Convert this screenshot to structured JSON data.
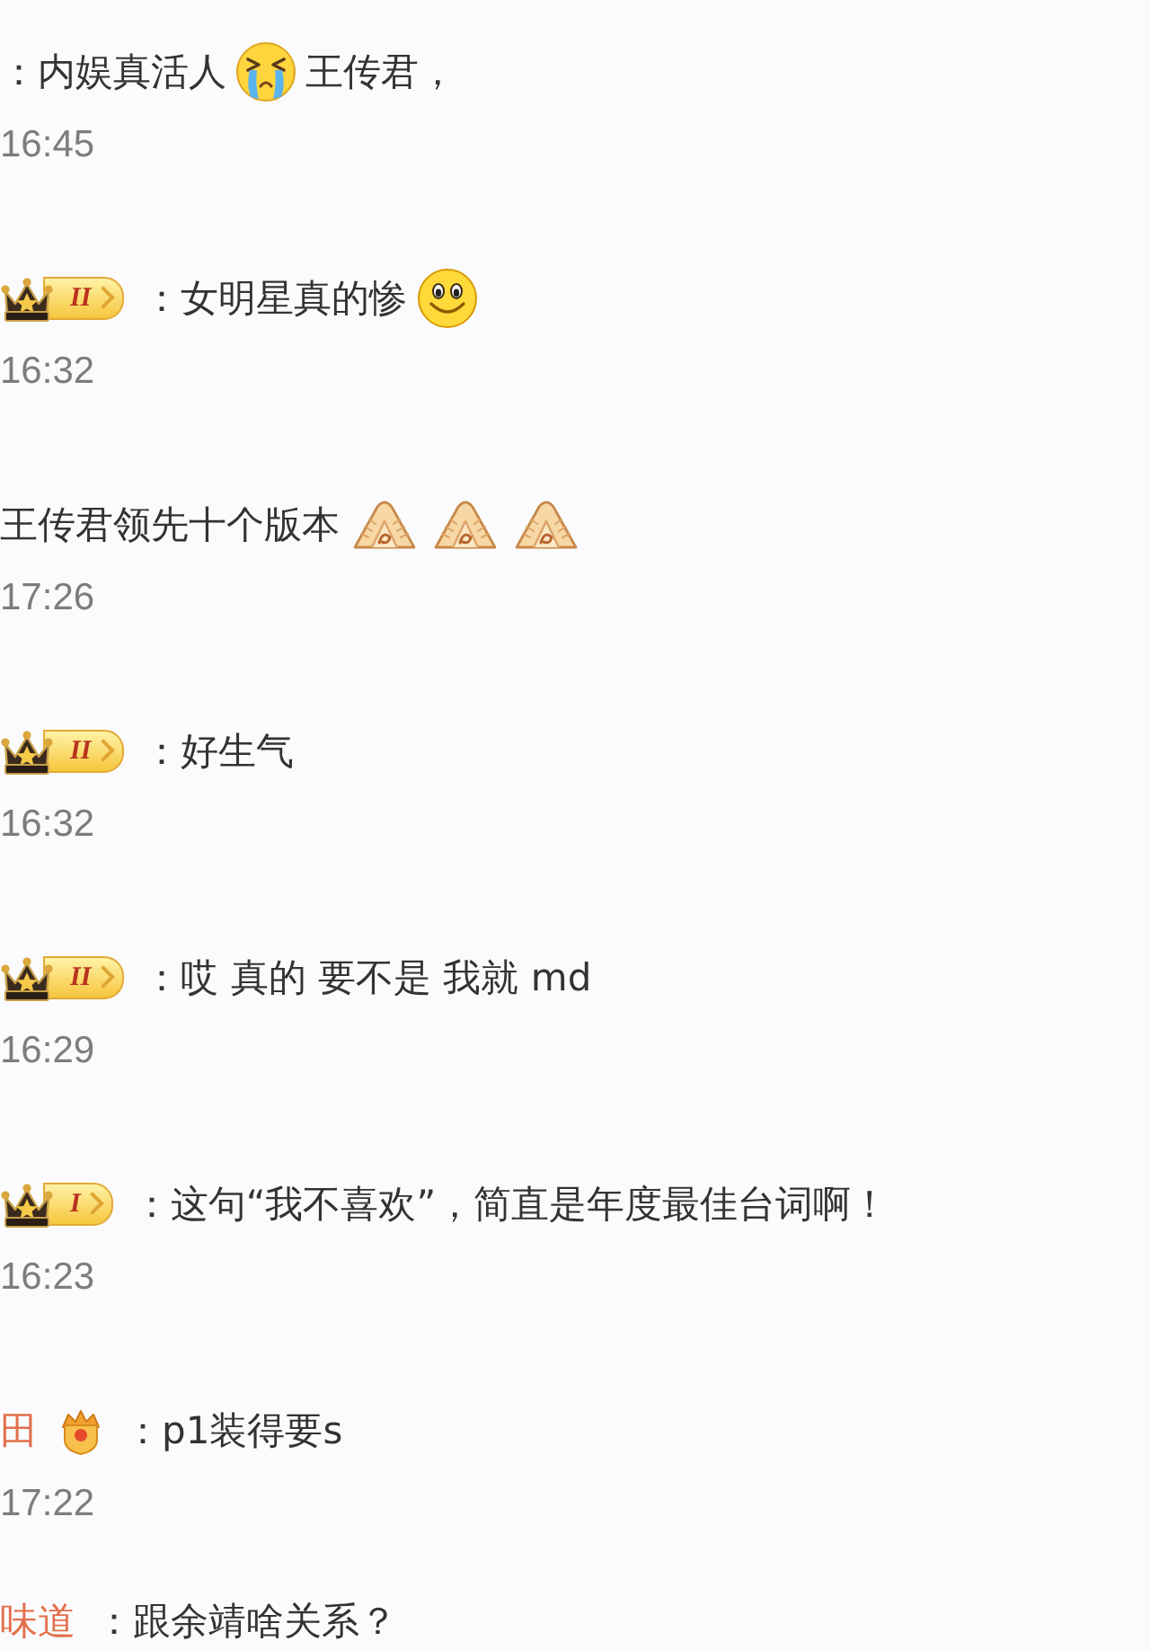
{
  "comments": [
    {
      "content": [
        {
          "kind": "text",
          "text": "：内娱真活人"
        },
        {
          "kind": "cry"
        },
        {
          "kind": "text",
          "text": "王传君，"
        }
      ],
      "time": "16:45"
    },
    {
      "badge": {
        "kind": "crown",
        "level": "II"
      },
      "content": [
        {
          "kind": "text",
          "text": "：女明星真的惨"
        },
        {
          "kind": "smile"
        }
      ],
      "time": "16:32"
    },
    {
      "content": [
        {
          "kind": "text",
          "text": "王传君领先十个版本"
        },
        {
          "kind": "hands"
        },
        {
          "kind": "hands"
        },
        {
          "kind": "hands"
        }
      ],
      "time": "17:26"
    },
    {
      "badge": {
        "kind": "crown",
        "level": "II"
      },
      "content": [
        {
          "kind": "text",
          "text": "：好生气"
        }
      ],
      "time": "16:32"
    },
    {
      "badge": {
        "kind": "crown",
        "level": "II"
      },
      "content": [
        {
          "kind": "text",
          "text": "：哎 真的 要不是 我就 md"
        }
      ],
      "time": "16:29"
    },
    {
      "badge": {
        "kind": "crown",
        "level": "I"
      },
      "content": [
        {
          "kind": "text",
          "text": "：这句“我不喜欢”，简直是年度最佳台词啊！"
        }
      ],
      "time": "16:23"
    },
    {
      "user": "田",
      "badge": {
        "kind": "shield"
      },
      "content": [
        {
          "kind": "text",
          "text": "：p1装得要s"
        }
      ],
      "time": "17:22"
    },
    {
      "user": "味道",
      "content": [
        {
          "kind": "text",
          "text": "：跟余靖啥关系？"
        }
      ]
    }
  ]
}
